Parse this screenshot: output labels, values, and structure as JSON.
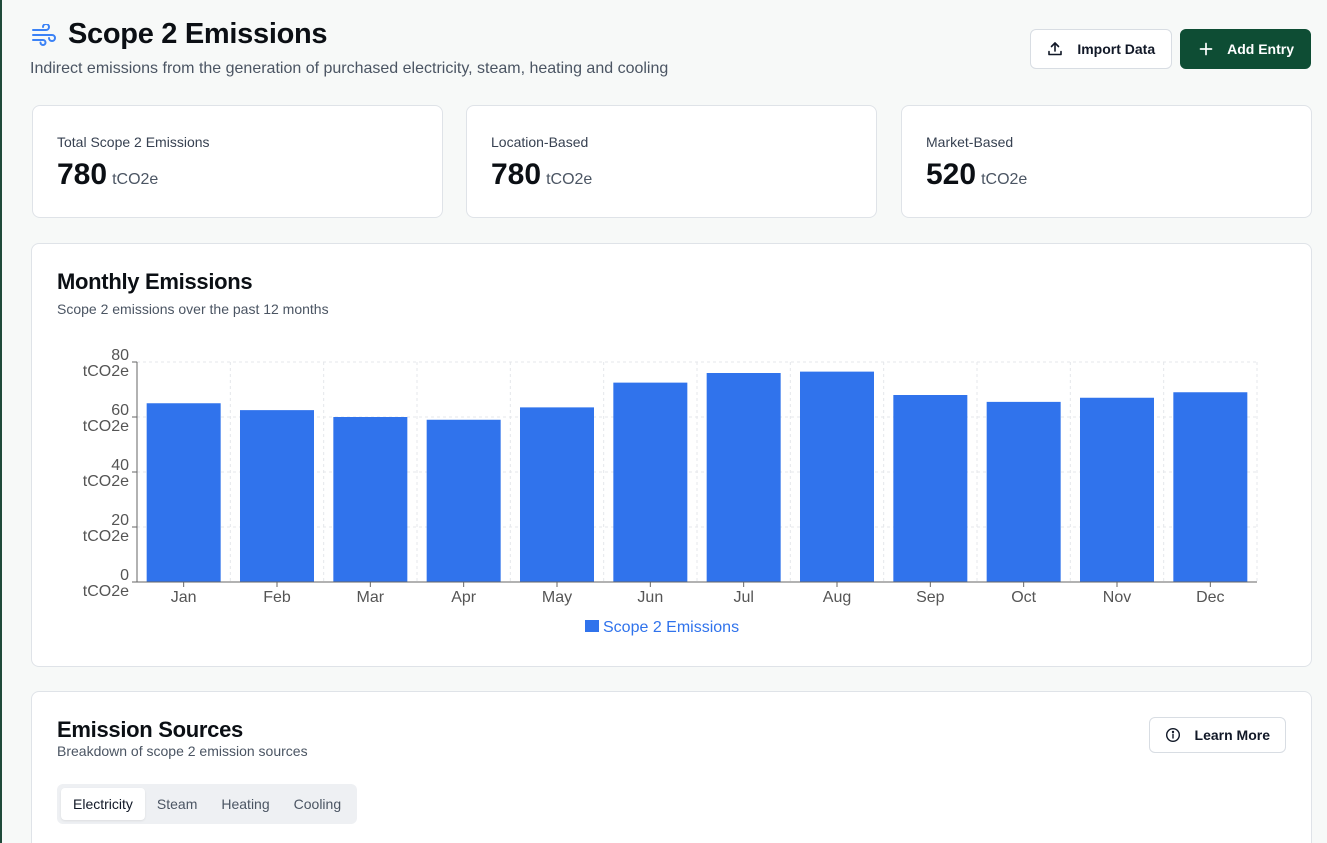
{
  "header": {
    "title": "Scope 2 Emissions",
    "subtitle": "Indirect emissions from the generation of purchased electricity, steam, heating and cooling",
    "title_icon": "wind-icon",
    "import_label": "Import Data",
    "add_label": "Add Entry"
  },
  "stats": [
    {
      "label": "Total Scope 2 Emissions",
      "value": "780",
      "unit": "tCO2e"
    },
    {
      "label": "Location-Based",
      "value": "780",
      "unit": "tCO2e"
    },
    {
      "label": "Market-Based",
      "value": "520",
      "unit": "tCO2e"
    }
  ],
  "monthly": {
    "title": "Monthly Emissions",
    "subtitle": "Scope 2 emissions over the past 12 months"
  },
  "chart_data": {
    "type": "bar",
    "categories": [
      "Jan",
      "Feb",
      "Mar",
      "Apr",
      "May",
      "Jun",
      "Jul",
      "Aug",
      "Sep",
      "Oct",
      "Nov",
      "Dec"
    ],
    "series": [
      {
        "name": "Scope 2 Emissions",
        "values": [
          65,
          62.5,
          60,
          59,
          63.5,
          72.5,
          76,
          76.5,
          68,
          65.5,
          67,
          69
        ]
      }
    ],
    "ylim": [
      0,
      80
    ],
    "yticks": [
      0,
      20,
      40,
      60,
      80
    ],
    "ytick_unit": "tCO2e",
    "grid": true,
    "legend": "bottom",
    "color": "#3073ec"
  },
  "sources": {
    "title": "Emission Sources",
    "subtitle": "Breakdown of scope 2 emission sources",
    "learn_label": "Learn More",
    "tabs": [
      "Electricity",
      "Steam",
      "Heating",
      "Cooling"
    ],
    "active_tab": "Electricity"
  },
  "colors": {
    "primary": "#0e4d34",
    "bar": "#3073ec",
    "icon_blue": "#3b82f6"
  }
}
